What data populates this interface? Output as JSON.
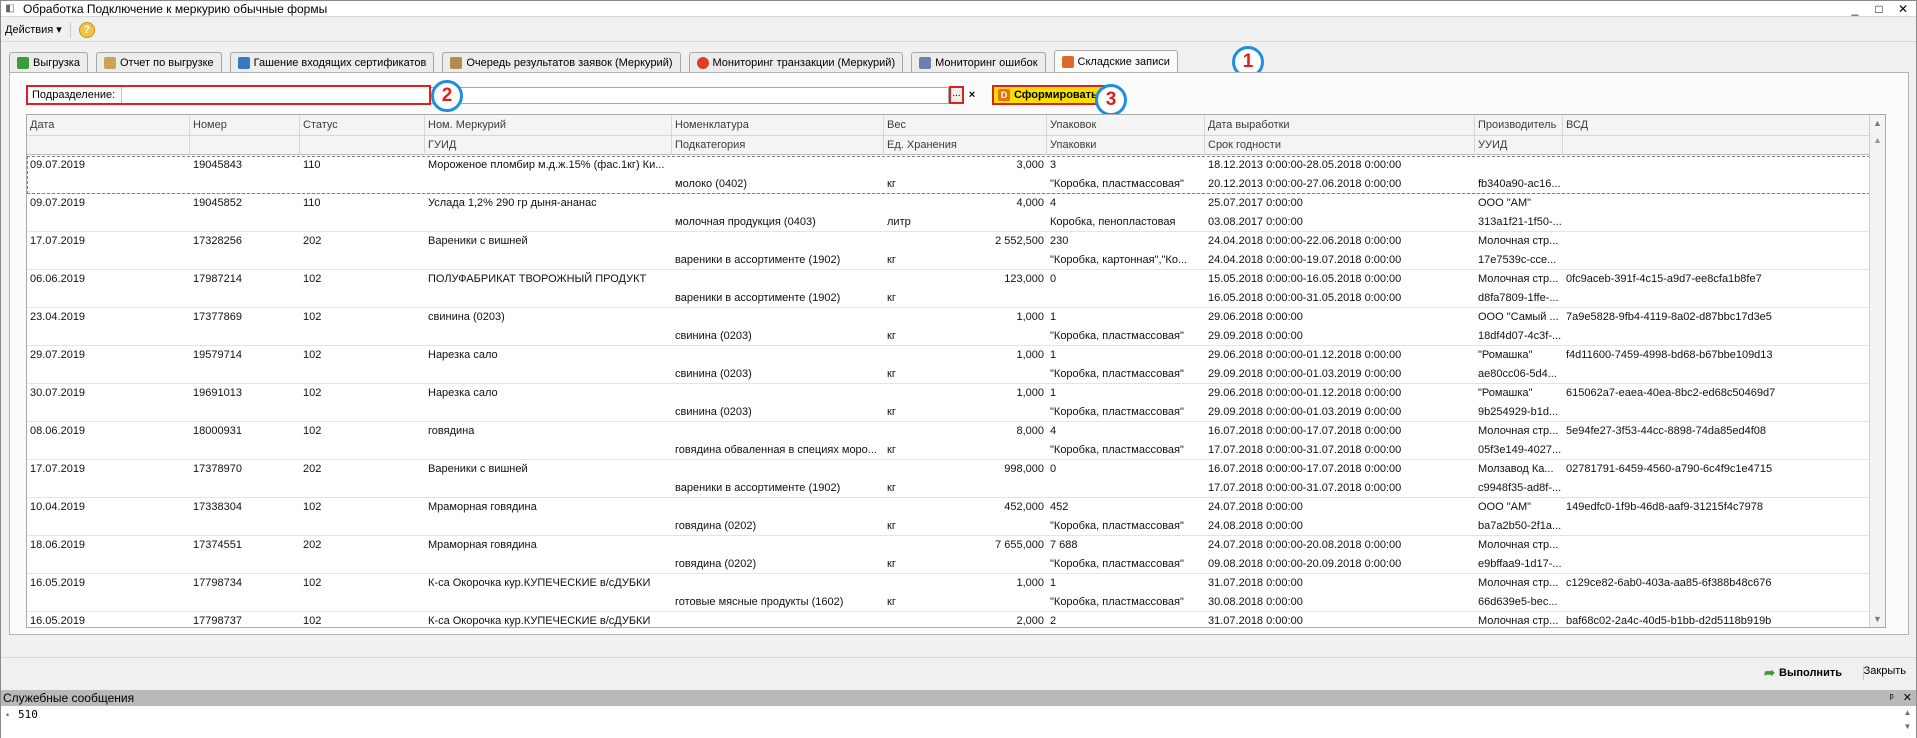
{
  "window": {
    "title": "Обработка  Подключение к меркурию обычные формы",
    "controls": [
      "_",
      "□",
      "✕"
    ]
  },
  "menu": {
    "actions": "Действия ▾",
    "help": "?"
  },
  "tabs": [
    {
      "label": "Выгрузка",
      "icon_color": "#3a9b3a"
    },
    {
      "label": "Отчет по выгрузке",
      "icon_color": "#caa25a"
    },
    {
      "label": "Гашение входящих сертификатов",
      "icon_color": "#3b78c4"
    },
    {
      "label": "Очередь результатов заявок (Меркурий)",
      "icon_color": "#b08d4f"
    },
    {
      "label": "Мониторинг транзакции (Меркурий)",
      "icon_color": "#d9402a"
    },
    {
      "label": "Мониторинг ошибок",
      "icon_color": "#6f7fae"
    },
    {
      "label": "Складские записи",
      "icon_color": "#d96a2a"
    }
  ],
  "markers": {
    "tab": "1",
    "filter": "2",
    "form": "3"
  },
  "filter": {
    "label": "Подразделение:",
    "value": "",
    "select_button": "...",
    "clear_button": "×",
    "form_button": "Сформировать"
  },
  "grid": {
    "header_row1": [
      "Дата",
      "Номер",
      "Статус",
      "Ном. Меркурий",
      "Номенклатура",
      "Вес",
      "Упаковок",
      "Дата выработки",
      "Производитель",
      "ВСД"
    ],
    "header_row2": [
      "",
      "",
      "",
      "ГУИД",
      "Подкатегория",
      "Ед. Хранения",
      "Упаковки",
      "Срок годности",
      "УУИД",
      ""
    ],
    "rows": [
      {
        "date": "09.07.2019",
        "number": "19045843",
        "status": "110",
        "merc_name": "Мороженое пломбир  м.д.ж.15% (фас.1кг) Ки...",
        "guid": "",
        "nomenclature": "",
        "subcategory": "молоко (0402)",
        "weight": "3,000",
        "unit": "кг",
        "packs": "3",
        "pack_type": "\"Коробка, пластмассовая\"",
        "prod_date": "18.12.2013 0:00:00-28.05.2018 0:00:00",
        "expiry": "20.12.2013 0:00:00-27.06.2018 0:00:00",
        "producer": "",
        "uuid": "fb340a90-ac16...",
        "vsd": ""
      },
      {
        "date": "09.07.2019",
        "number": "19045852",
        "status": "110",
        "merc_name": "Услада 1,2% 290 гр дыня-ананас",
        "guid": "",
        "nomenclature": "",
        "subcategory": "молочная продукция (0403)",
        "weight": "4,000",
        "unit": "литр",
        "packs": "4",
        "pack_type": "Коробка, пенопластовая",
        "prod_date": "25.07.2017 0:00:00",
        "expiry": "03.08.2017 0:00:00",
        "producer": "ООО \"АМ\"",
        "uuid": "313a1f21-1f50-...",
        "vsd": ""
      },
      {
        "date": "17.07.2019",
        "number": "17328256",
        "status": "202",
        "merc_name": "Вареники с вишней",
        "guid": "",
        "nomenclature": "",
        "subcategory": "вареники в ассортименте (1902)",
        "weight": "2 552,500",
        "unit": "кг",
        "packs": "230",
        "pack_type": "\"Коробка, картонная\",\"Ко...",
        "prod_date": "24.04.2018 0:00:00-22.06.2018 0:00:00",
        "expiry": "24.04.2018 0:00:00-19.07.2018 0:00:00",
        "producer": "Молочная стр...",
        "uuid": "17e7539c-cce...",
        "vsd": ""
      },
      {
        "date": "06.06.2019",
        "number": "17987214",
        "status": "102",
        "merc_name": "ПОЛУФАБРИКАТ ТВОРОЖНЫЙ ПРОДУКТ",
        "guid": "",
        "nomenclature": "",
        "subcategory": "вареники в ассортименте (1902)",
        "weight": "123,000",
        "unit": "кг",
        "packs": "0",
        "pack_type": "",
        "prod_date": "15.05.2018 0:00:00-16.05.2018 0:00:00",
        "expiry": "16.05.2018 0:00:00-31.05.2018 0:00:00",
        "producer": "Молочная стр...",
        "uuid": "d8fa7809-1ffe-...",
        "vsd": "0fc9aceb-391f-4c15-a9d7-ee8cfa1b8fe7"
      },
      {
        "date": "23.04.2019",
        "number": "17377869",
        "status": "102",
        "merc_name": "свинина (0203)",
        "guid": "",
        "nomenclature": "",
        "subcategory": "свинина (0203)",
        "weight": "1,000",
        "unit": "кг",
        "packs": "1",
        "pack_type": "\"Коробка, пластмассовая\"",
        "prod_date": "29.06.2018 0:00:00",
        "expiry": "29.09.2018 0:00:00",
        "producer": "ООО \"Самый ...",
        "uuid": "18df4d07-4c3f-...",
        "vsd": "7a9e5828-9fb4-4119-8a02-d87bbc17d3e5"
      },
      {
        "date": "29.07.2019",
        "number": "19579714",
        "status": "102",
        "merc_name": "Нарезка сало",
        "guid": "",
        "nomenclature": "",
        "subcategory": "свинина (0203)",
        "weight": "1,000",
        "unit": "кг",
        "packs": "1",
        "pack_type": "\"Коробка, пластмассовая\"",
        "prod_date": "29.06.2018 0:00:00-01.12.2018 0:00:00",
        "expiry": "29.09.2018 0:00:00-01.03.2019 0:00:00",
        "producer": "\"Ромашка\"",
        "uuid": "ae80cc06-5d4...",
        "vsd": "f4d11600-7459-4998-bd68-b67bbe109d13"
      },
      {
        "date": "30.07.2019",
        "number": "19691013",
        "status": "102",
        "merc_name": "Нарезка сало",
        "guid": "",
        "nomenclature": "",
        "subcategory": "свинина (0203)",
        "weight": "1,000",
        "unit": "кг",
        "packs": "1",
        "pack_type": "\"Коробка, пластмассовая\"",
        "prod_date": "29.06.2018 0:00:00-01.12.2018 0:00:00",
        "expiry": "29.09.2018 0:00:00-01.03.2019 0:00:00",
        "producer": "\"Ромашка\"",
        "uuid": "9b254929-b1d...",
        "vsd": "615062a7-eaea-40ea-8bc2-ed68c50469d7"
      },
      {
        "date": "08.06.2019",
        "number": "18000931",
        "status": "102",
        "merc_name": "говядина",
        "guid": "",
        "nomenclature": "",
        "subcategory": "говядина обваленная в специях моро...",
        "weight": "8,000",
        "unit": "кг",
        "packs": "4",
        "pack_type": "\"Коробка, пластмассовая\"",
        "prod_date": "16.07.2018 0:00:00-17.07.2018 0:00:00",
        "expiry": "17.07.2018 0:00:00-31.07.2018 0:00:00",
        "producer": "Молочная стр...",
        "uuid": "05f3e149-4027...",
        "vsd": "5e94fe27-3f53-44cc-8898-74da85ed4f08"
      },
      {
        "date": "17.07.2019",
        "number": "17378970",
        "status": "202",
        "merc_name": "Вареники с вишней",
        "guid": "",
        "nomenclature": "",
        "subcategory": "вареники в ассортименте (1902)",
        "weight": "998,000",
        "unit": "кг",
        "packs": "0",
        "pack_type": "",
        "prod_date": "16.07.2018 0:00:00-17.07.2018 0:00:00",
        "expiry": "17.07.2018 0:00:00-31.07.2018 0:00:00",
        "producer": "Молзавод Ка...",
        "uuid": "c9948f35-ad8f-...",
        "vsd": "02781791-6459-4560-a790-6c4f9c1e4715"
      },
      {
        "date": "10.04.2019",
        "number": "17338304",
        "status": "102",
        "merc_name": "Мраморная говядина",
        "guid": "",
        "nomenclature": "",
        "subcategory": "говядина (0202)",
        "weight": "452,000",
        "unit": "кг",
        "packs": "452",
        "pack_type": "\"Коробка, пластмассовая\"",
        "prod_date": "24.07.2018 0:00:00",
        "expiry": "24.08.2018 0:00:00",
        "producer": "ООО \"АМ\"",
        "uuid": "ba7a2b50-2f1a...",
        "vsd": "149edfc0-1f9b-46d8-aaf9-31215f4c7978"
      },
      {
        "date": "18.06.2019",
        "number": "17374551",
        "status": "202",
        "merc_name": "Мраморная говядина",
        "guid": "",
        "nomenclature": "",
        "subcategory": "говядина (0202)",
        "weight": "7 655,000",
        "unit": "кг",
        "packs": "7 688",
        "pack_type": "\"Коробка, пластмассовая\"",
        "prod_date": "24.07.2018 0:00:00-20.08.2018 0:00:00",
        "expiry": "09.08.2018 0:00:00-20.09.2018 0:00:00",
        "producer": "Молочная стр...",
        "uuid": "e9bffaa9-1d17-...",
        "vsd": ""
      },
      {
        "date": "16.05.2019",
        "number": "17798734",
        "status": "102",
        "merc_name": "К-са Окорочка кур.КУПЕЧЕСКИЕ в/сДУБКИ",
        "guid": "",
        "nomenclature": "",
        "subcategory": "готовые мясные продукты (1602)",
        "weight": "1,000",
        "unit": "кг",
        "packs": "1",
        "pack_type": "\"Коробка, пластмассовая\"",
        "prod_date": "31.07.2018 0:00:00",
        "expiry": "30.08.2018 0:00:00",
        "producer": "Молочная стр...",
        "uuid": "66d639e5-bec...",
        "vsd": "c129ce82-6ab0-403a-aa85-6f388b48c676"
      },
      {
        "date": "16.05.2019",
        "number": "17798737",
        "status": "102",
        "merc_name": "К-са Окорочка кур.КУПЕЧЕСКИЕ в/сДУБКИ",
        "guid": "",
        "nomenclature": "",
        "subcategory": "",
        "weight": "2,000",
        "unit": "",
        "packs": "2",
        "pack_type": "",
        "prod_date": "31.07.2018 0:00:00",
        "expiry": "",
        "producer": "Молочная стр...",
        "uuid": "",
        "vsd": "baf68c02-2a4c-40d5-b1bb-d2d5118b919b"
      }
    ]
  },
  "footer": {
    "run_button": "Выполнить",
    "close_button": "Закрыть"
  },
  "service": {
    "title": "Служебные сообщения",
    "pin": "ᵖ",
    "close": "✕",
    "message": "510"
  }
}
